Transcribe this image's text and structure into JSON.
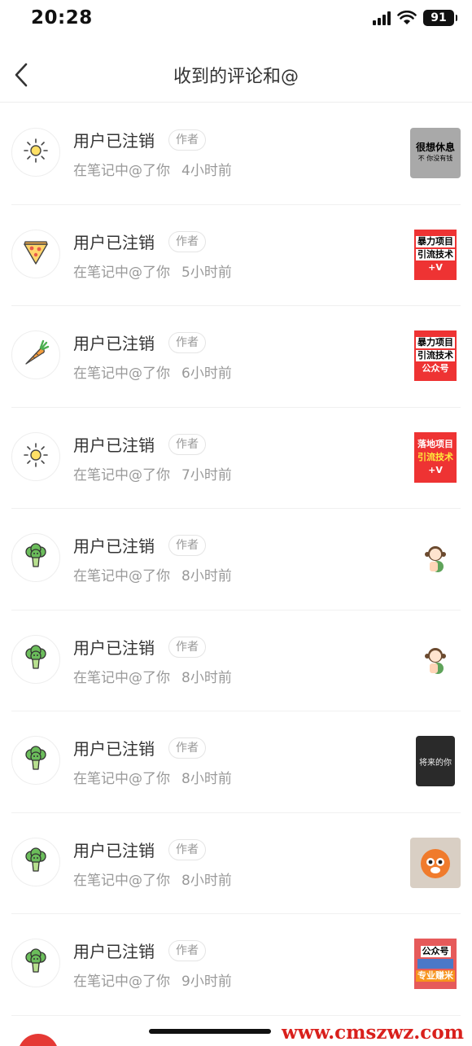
{
  "status_bar": {
    "time": "20:28",
    "battery": "91"
  },
  "header": {
    "title": "收到的评论和@"
  },
  "items": [
    {
      "name": "用户已注销",
      "tag": "作者",
      "action": "在笔记中@了你",
      "time": "4小时前",
      "avatar_icon": "sun-icon",
      "thumb_type": "gray",
      "thumb_lines": [
        "很想休息",
        "不  你没有钱"
      ]
    },
    {
      "name": "用户已注销",
      "tag": "作者",
      "action": "在笔记中@了你",
      "time": "5小时前",
      "avatar_icon": "pizza-icon",
      "thumb_type": "red",
      "thumb_lines": [
        "暴力项目",
        "引流技术",
        "+V"
      ]
    },
    {
      "name": "用户已注销",
      "tag": "作者",
      "action": "在笔记中@了你",
      "time": "6小时前",
      "avatar_icon": "carrot-icon",
      "thumb_type": "red",
      "thumb_lines": [
        "暴力项目",
        "引流技术",
        "公众号"
      ]
    },
    {
      "name": "用户已注销",
      "tag": "作者",
      "action": "在笔记中@了你",
      "time": "7小时前",
      "avatar_icon": "sun-icon",
      "thumb_type": "red2",
      "thumb_lines": [
        "落地项目",
        "引流技术",
        "+V"
      ]
    },
    {
      "name": "用户已注销",
      "tag": "作者",
      "action": "在笔记中@了你",
      "time": "8小时前",
      "avatar_icon": "broccoli-icon",
      "thumb_type": "blank",
      "thumb_lines": []
    },
    {
      "name": "用户已注销",
      "tag": "作者",
      "action": "在笔记中@了你",
      "time": "8小时前",
      "avatar_icon": "broccoli-icon",
      "thumb_type": "blank",
      "thumb_lines": []
    },
    {
      "name": "用户已注销",
      "tag": "作者",
      "action": "在笔记中@了你",
      "time": "8小时前",
      "avatar_icon": "broccoli-icon",
      "thumb_type": "dark",
      "thumb_lines": [
        "将来的你"
      ]
    },
    {
      "name": "用户已注销",
      "tag": "作者",
      "action": "在笔记中@了你",
      "time": "8小时前",
      "avatar_icon": "broccoli-icon",
      "thumb_type": "orange",
      "thumb_lines": []
    },
    {
      "name": "用户已注销",
      "tag": "作者",
      "action": "在笔记中@了你",
      "time": "9小时前",
      "avatar_icon": "broccoli-icon",
      "thumb_type": "red3",
      "thumb_lines": [
        "公众号",
        "专业赚米"
      ]
    }
  ],
  "watermark": "www.cmszwz.com"
}
